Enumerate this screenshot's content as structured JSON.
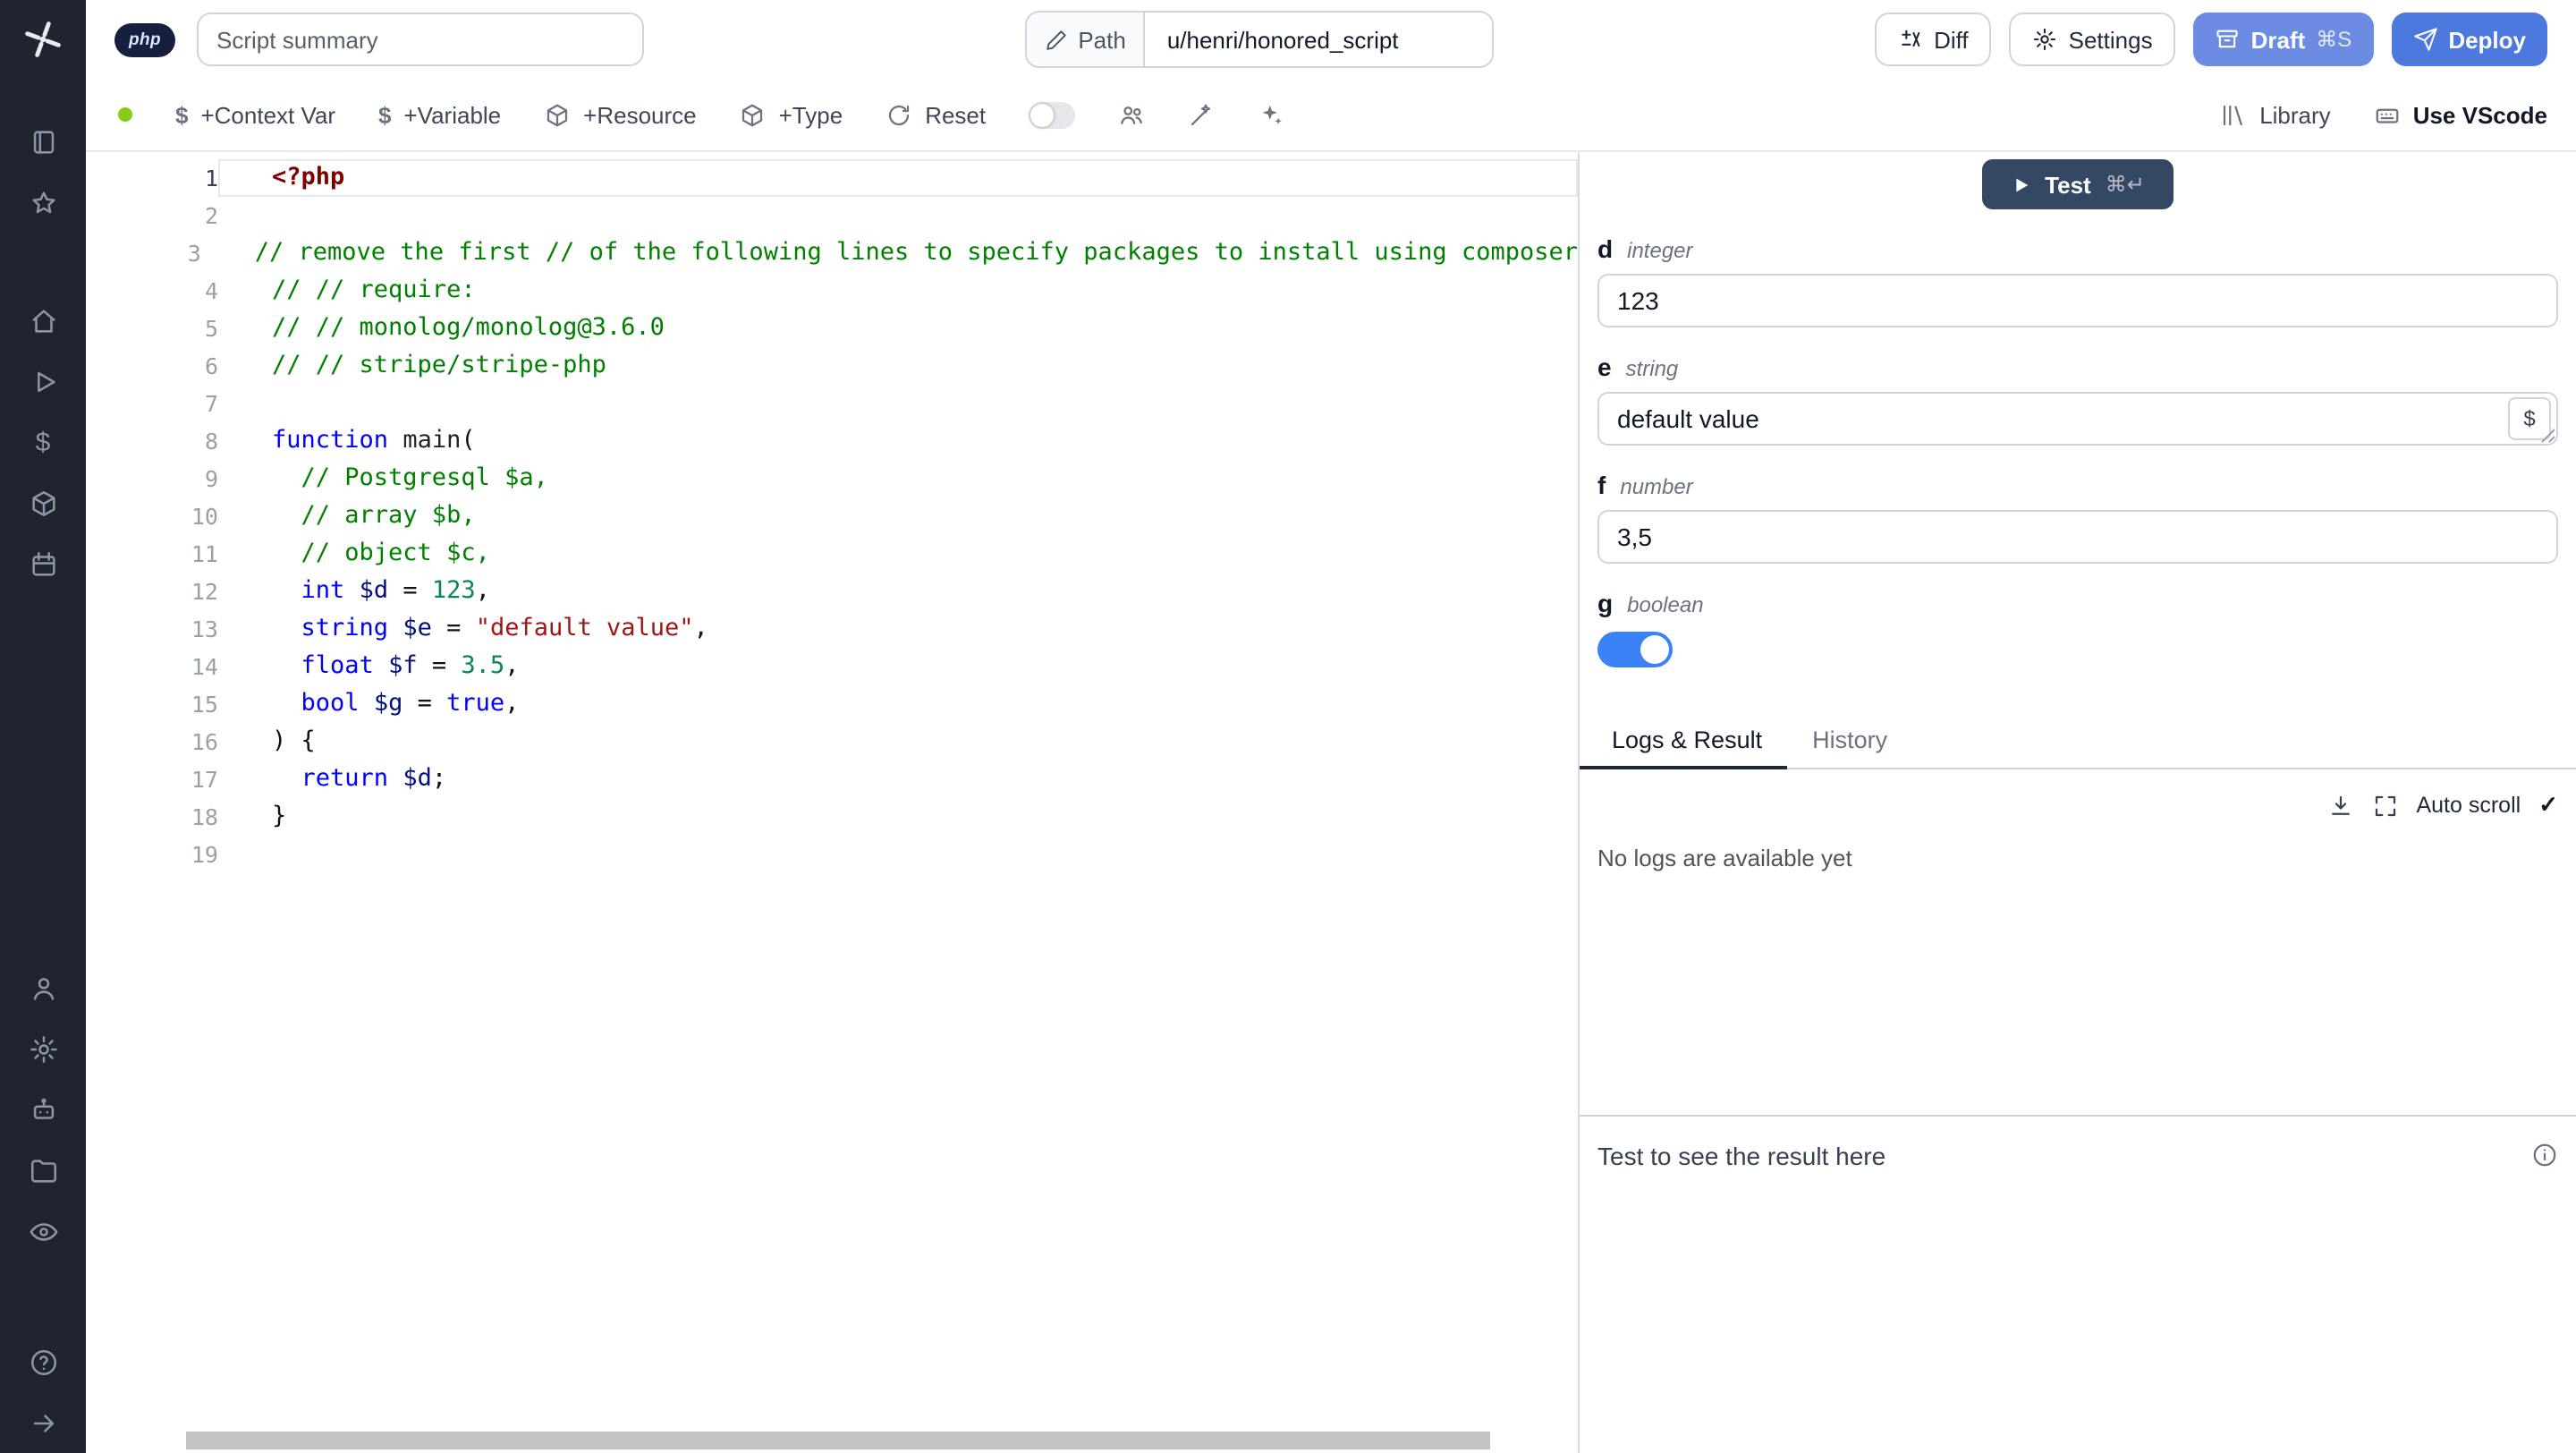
{
  "topbar": {
    "language_badge": "php",
    "summary_placeholder": "Script summary",
    "path_label": "Path",
    "path_value": "u/henri/honored_script",
    "diff_label": "Diff",
    "settings_label": "Settings",
    "draft_label": "Draft",
    "draft_shortcut": "⌘S",
    "deploy_label": "Deploy"
  },
  "toolbar": {
    "context_var_label": "+Context Var",
    "variable_label": "+Variable",
    "resource_label": "+Resource",
    "type_label": "+Type",
    "reset_label": "Reset",
    "library_label": "Library",
    "vscode_label": "Use VScode",
    "status_dot_color": "#84cc16",
    "icons": [
      "dollar",
      "dollar",
      "cube",
      "cube",
      "reset",
      "multiplayer-toggle",
      "users",
      "format-wand",
      "ai-sparkles",
      "library-shelf",
      "keyboard"
    ]
  },
  "sidebar": {
    "items": [
      {
        "icon": "book"
      },
      {
        "icon": "star"
      },
      {
        "icon": "home"
      },
      {
        "icon": "runs-play"
      },
      {
        "icon": "variables-dollar"
      },
      {
        "icon": "resources-cube"
      },
      {
        "icon": "schedules-calendar"
      },
      {
        "icon": "user"
      },
      {
        "icon": "settings-gear"
      },
      {
        "icon": "workers-bot"
      },
      {
        "icon": "folders"
      },
      {
        "icon": "audit-eye"
      },
      {
        "icon": "help"
      },
      {
        "icon": "expand-arrow"
      }
    ]
  },
  "editor": {
    "language": "php",
    "lines": [
      {
        "n": 1,
        "current": true,
        "tokens": [
          {
            "c": "meta",
            "t": "<?php"
          }
        ]
      },
      {
        "n": 2,
        "tokens": []
      },
      {
        "n": 3,
        "tokens": [
          {
            "c": "com",
            "t": "// remove the first // of the following lines to specify packages to install using composer"
          }
        ]
      },
      {
        "n": 4,
        "tokens": [
          {
            "c": "com",
            "t": "// // require:"
          }
        ]
      },
      {
        "n": 5,
        "tokens": [
          {
            "c": "com",
            "t": "// // monolog/monolog@3.6.0"
          }
        ]
      },
      {
        "n": 6,
        "tokens": [
          {
            "c": "com",
            "t": "// // stripe/stripe-php"
          }
        ]
      },
      {
        "n": 7,
        "tokens": []
      },
      {
        "n": 8,
        "tokens": [
          {
            "c": "kw",
            "t": "function"
          },
          {
            "c": "pl",
            "t": " "
          },
          {
            "c": "fn",
            "t": "main"
          },
          {
            "c": "pl",
            "t": "("
          }
        ]
      },
      {
        "n": 9,
        "tokens": [
          {
            "c": "com",
            "t": "  // Postgresql $a,"
          }
        ]
      },
      {
        "n": 10,
        "tokens": [
          {
            "c": "com",
            "t": "  // array $b,"
          }
        ]
      },
      {
        "n": 11,
        "tokens": [
          {
            "c": "com",
            "t": "  // object $c,"
          }
        ]
      },
      {
        "n": 12,
        "tokens": [
          {
            "c": "pl",
            "t": "  "
          },
          {
            "c": "kw",
            "t": "int"
          },
          {
            "c": "pl",
            "t": " "
          },
          {
            "c": "var",
            "t": "$d"
          },
          {
            "c": "pl",
            "t": " = "
          },
          {
            "c": "num",
            "t": "123"
          },
          {
            "c": "pl",
            "t": ","
          }
        ]
      },
      {
        "n": 13,
        "tokens": [
          {
            "c": "pl",
            "t": "  "
          },
          {
            "c": "kw",
            "t": "string"
          },
          {
            "c": "pl",
            "t": " "
          },
          {
            "c": "var",
            "t": "$e"
          },
          {
            "c": "pl",
            "t": " = "
          },
          {
            "c": "str",
            "t": "\"default value\""
          },
          {
            "c": "pl",
            "t": ","
          }
        ]
      },
      {
        "n": 14,
        "tokens": [
          {
            "c": "pl",
            "t": "  "
          },
          {
            "c": "kw",
            "t": "float"
          },
          {
            "c": "pl",
            "t": " "
          },
          {
            "c": "var",
            "t": "$f"
          },
          {
            "c": "pl",
            "t": " = "
          },
          {
            "c": "num",
            "t": "3.5"
          },
          {
            "c": "pl",
            "t": ","
          }
        ]
      },
      {
        "n": 15,
        "tokens": [
          {
            "c": "pl",
            "t": "  "
          },
          {
            "c": "kw",
            "t": "bool"
          },
          {
            "c": "pl",
            "t": " "
          },
          {
            "c": "var",
            "t": "$g"
          },
          {
            "c": "pl",
            "t": " = "
          },
          {
            "c": "kw",
            "t": "true"
          },
          {
            "c": "pl",
            "t": ","
          }
        ]
      },
      {
        "n": 16,
        "tokens": [
          {
            "c": "pl",
            "t": ") {"
          }
        ]
      },
      {
        "n": 17,
        "tokens": [
          {
            "c": "pl",
            "t": "  "
          },
          {
            "c": "kw",
            "t": "return"
          },
          {
            "c": "pl",
            "t": " "
          },
          {
            "c": "var",
            "t": "$d"
          },
          {
            "c": "pl",
            "t": ";"
          }
        ]
      },
      {
        "n": 18,
        "tokens": [
          {
            "c": "pl",
            "t": "}"
          }
        ]
      },
      {
        "n": 19,
        "tokens": []
      }
    ]
  },
  "right_panel": {
    "test_button": {
      "label": "Test",
      "shortcut": "⌘↵"
    },
    "fields": [
      {
        "name": "d",
        "type": "integer",
        "value": "123"
      },
      {
        "name": "e",
        "type": "string",
        "value": "default value",
        "suffix_button": "$"
      },
      {
        "name": "f",
        "type": "number",
        "value": "3,5"
      },
      {
        "name": "g",
        "type": "boolean",
        "value": true
      }
    ],
    "tabs": [
      {
        "label": "Logs & Result",
        "active": true
      },
      {
        "label": "History",
        "active": false
      }
    ],
    "logs": {
      "auto_scroll_label": "Auto scroll",
      "empty_text": "No logs are available yet",
      "icons": [
        "download",
        "expand",
        "check"
      ]
    },
    "result": {
      "placeholder": "Test to see the result here",
      "icon": "info"
    }
  },
  "colors": {
    "sidebar_bg": "#1f242e",
    "draft_button": "#6b8ce2",
    "deploy_button": "#4d78dd",
    "test_button": "#344763",
    "toggle_on": "#3b82f6",
    "status_dot": "#84cc16",
    "ai_sparkle": "#8b5cf6"
  }
}
